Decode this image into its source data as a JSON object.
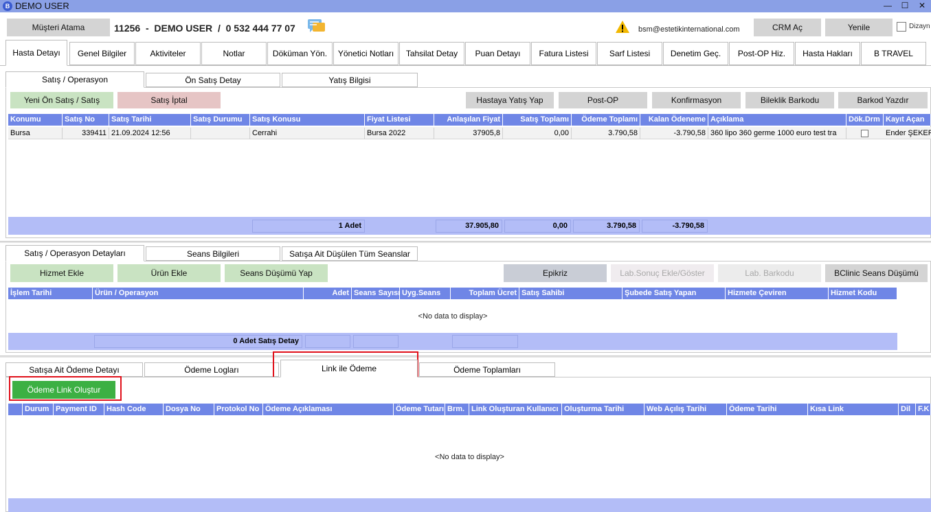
{
  "window": {
    "title": "DEMO USER",
    "minimize": "—",
    "maximize": "☐",
    "close": "✕"
  },
  "topbar": {
    "assign_button": "Müşteri Atama",
    "patient_info": "11256  -  DEMO USER  /  0 532 444 77 07",
    "email": "bsm@estetikinternational.com",
    "crm_button": "CRM Aç",
    "refresh_button": "Yenile",
    "design_label": "Dizayn"
  },
  "main_tabs": [
    "Hasta Detayı",
    "Genel Bilgiler",
    "Aktiviteler",
    "Notlar",
    "Döküman Yön.",
    "Yönetici Notları",
    "Tahsilat Detay",
    "Puan Detayı",
    "Fatura Listesi",
    "Sarf Listesi",
    "Denetim Geç.",
    "Post-OP Hiz.",
    "Hasta Hakları",
    "B TRAVEL"
  ],
  "sales": {
    "tabs": [
      "Satış / Operasyon",
      "Ön Satış Detay",
      "Yatış Bilgisi"
    ],
    "buttons": {
      "new_sale": "Yeni Ön Satış / Satış",
      "cancel_sale": "Satış İptal",
      "admit": "Hastaya Yatış Yap",
      "post_op": "Post-OP",
      "confirm": "Konfirmasyon",
      "bracelet": "Bileklik Barkodu",
      "barcode": "Barkod Yazdır"
    },
    "columns": [
      "Konumu",
      "Satış No",
      "Satış Tarihi",
      "Satış Durumu",
      "Satış Konusu",
      "Fiyat Listesi",
      "Anlaşılan Fiyat",
      "Satış Toplamı",
      "Ödeme Toplamı",
      "Kalan Ödeneme",
      "Açıklama",
      "Dök.Drm",
      "Kayıt Açan"
    ],
    "row": {
      "konum": "Bursa",
      "satis_no": "339411",
      "tarih": "21.09.2024 12:56",
      "durum": "",
      "konu": "Cerrahi",
      "fiyat_listesi": "Bursa 2022",
      "anlasilan": "37905,8",
      "satis_toplam": "0,00",
      "odeme_toplam": "3.790,58",
      "kalan": "-3.790,58",
      "aciklama": "360 lipo 360 germe 1000 euro test tra",
      "kayit_acan": "Ender ŞEKER"
    },
    "totals": {
      "count": "1 Adet",
      "anlasilan": "37.905,80",
      "satis": "0,00",
      "odeme": "3.790,58",
      "kalan": "-3.790,58"
    }
  },
  "details": {
    "tabs": [
      "Satış / Operasyon Detayları",
      "Seans Bilgileri",
      "Satışa Ait Düşülen Tüm Seanslar"
    ],
    "buttons": {
      "add_service": "Hizmet Ekle",
      "add_product": "Ürün Ekle",
      "session_deduct": "Seans Düşümü Yap",
      "epikriz": "Epikriz",
      "lab_result": "Lab.Sonuç Ekle/Göster",
      "lab_barcode": "Lab. Barkodu",
      "bclinic": "BClinic Seans Düşümü"
    },
    "columns": [
      "İşlem Tarihi",
      "Ürün / Operasyon",
      "Adet",
      "Seans Sayısı",
      "Uyg.Seans",
      "Toplam Ücret",
      "Satış Sahibi",
      "Şubede Satış Yapan",
      "Hizmete Çeviren",
      "Hizmet Kodu"
    ],
    "nodata": "<No data to display>",
    "footer": "0 Adet Satış Detay"
  },
  "payments": {
    "tabs": [
      "Satışa Ait Ödeme Detayı",
      "Ödeme Logları",
      "Link ile Ödeme",
      "Ödeme Toplamları"
    ],
    "create_link_button": "Ödeme Link Oluştur",
    "columns": [
      "Durum",
      "Payment ID",
      "Hash Code",
      "Dosya No",
      "Protokol No",
      "Ödeme Açıklaması",
      "Ödeme Tutarı",
      "Brm.",
      "Link Oluşturan Kullanıcı",
      "Oluşturma Tarihi",
      "Web Açılış Tarihi",
      "Ödeme Tarihi",
      "Kısa Link",
      "Dil",
      "F.K"
    ],
    "nodata": "<No data to display>"
  },
  "colors": {
    "header": "#6f86e6",
    "titlebar": "#8aa0e6",
    "green": "#3cb043",
    "highlight": "#e0101a"
  }
}
